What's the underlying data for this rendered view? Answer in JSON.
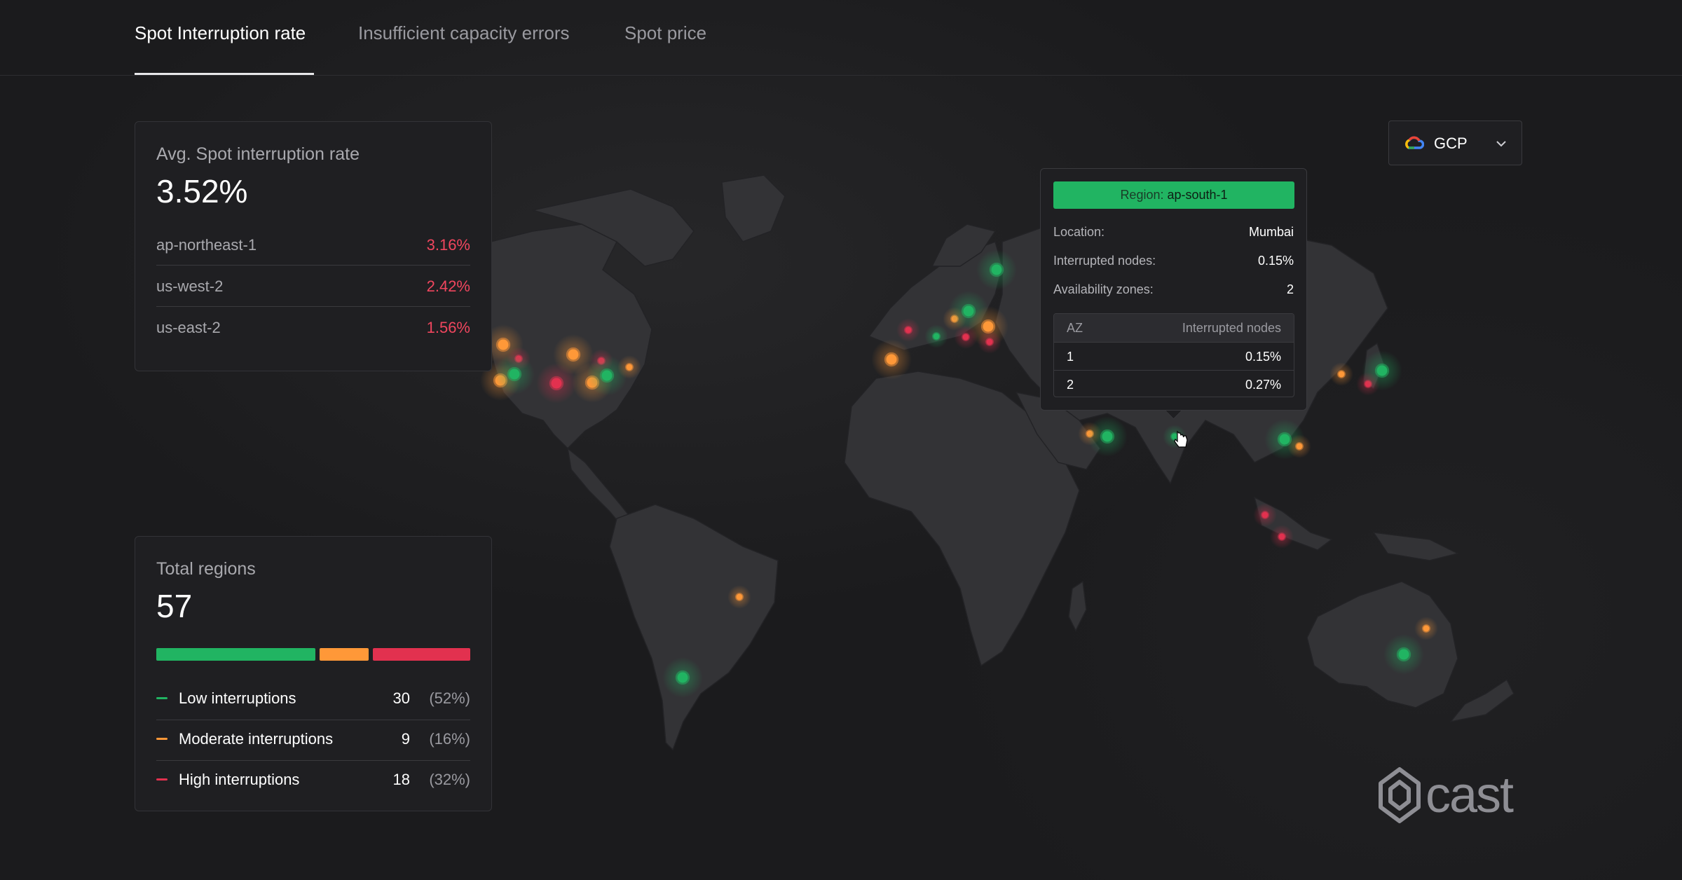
{
  "tabs": [
    {
      "label": "Spot Interruption rate",
      "active": true
    },
    {
      "label": "Insufficient capacity errors",
      "active": false
    },
    {
      "label": "Spot price",
      "active": false
    }
  ],
  "avg_card": {
    "title": "Avg. Spot interruption rate",
    "value": "3.52%",
    "rows": [
      {
        "region": "ap-northeast-1",
        "rate": "3.16%"
      },
      {
        "region": "us-west-2",
        "rate": "2.42%"
      },
      {
        "region": "us-east-2",
        "rate": "1.56%"
      }
    ]
  },
  "regions_card": {
    "title": "Total regions",
    "value": "57",
    "distribution": [
      {
        "level": "low",
        "fraction": 0.52,
        "color": "#21b462"
      },
      {
        "level": "moderate",
        "fraction": 0.16,
        "color": "#ff9838"
      },
      {
        "level": "high",
        "fraction": 0.32,
        "color": "#e2314f"
      }
    ],
    "legend": [
      {
        "label": "Low interruptions",
        "count": "30",
        "percent": "(52%)",
        "color": "#21b462"
      },
      {
        "label": "Moderate interruptions",
        "count": "9",
        "percent": "(16%)",
        "color": "#ff9838"
      },
      {
        "label": "High interruptions",
        "count": "18",
        "percent": "(32%)",
        "color": "#e2314f"
      }
    ]
  },
  "provider": {
    "label": "GCP",
    "icon": "google-cloud-icon"
  },
  "tooltip": {
    "region_key": "Region:",
    "region_value": "ap-south-1",
    "location_key": "Location:",
    "location_value": "Mumbai",
    "interrupted_key": "Interrupted nodes:",
    "interrupted_value": "0.15%",
    "zones_key": "Availability zones:",
    "zones_value": "2",
    "table": {
      "headers": [
        "AZ",
        "Interrupted nodes"
      ],
      "rows": [
        {
          "az": "1",
          "value": "0.15%"
        },
        {
          "az": "2",
          "value": "0.27%"
        }
      ]
    }
  },
  "logo": {
    "text": "cast"
  },
  "colors": {
    "low": "#21b462",
    "moderate": "#ff9838",
    "high": "#e2314f"
  }
}
